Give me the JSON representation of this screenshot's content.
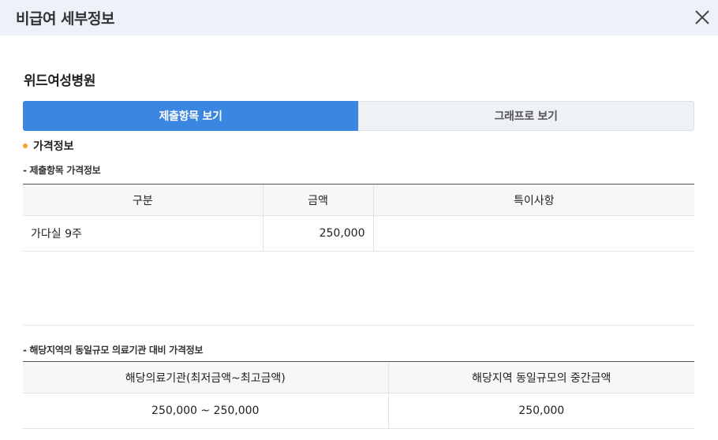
{
  "header": {
    "title": "비급여 세부정보"
  },
  "hospital_name": "위드여성병원",
  "tabs": [
    {
      "label": "제출항목 보기",
      "active": true
    },
    {
      "label": "그래프로 보기",
      "active": false
    }
  ],
  "section": {
    "title": "가격정보"
  },
  "table1": {
    "caption": "- 제출항목 가격정보",
    "headers": [
      "구분",
      "금액",
      "특이사항"
    ],
    "rows": [
      [
        "가다실 9주",
        "250,000",
        ""
      ]
    ]
  },
  "table2": {
    "caption": "- 해당지역의 동일규모 의료기관 대비 가격정보",
    "headers": [
      "해당의료기관(최저금액~최고금액)",
      "해당지역 동일규모의 중간금액"
    ],
    "rows": [
      [
        "250,000 ~ 250,000",
        "250,000"
      ]
    ]
  },
  "colors": {
    "accent": "#3a86e0",
    "bullet": "#f5a623",
    "header_bg": "#edf2f8"
  }
}
